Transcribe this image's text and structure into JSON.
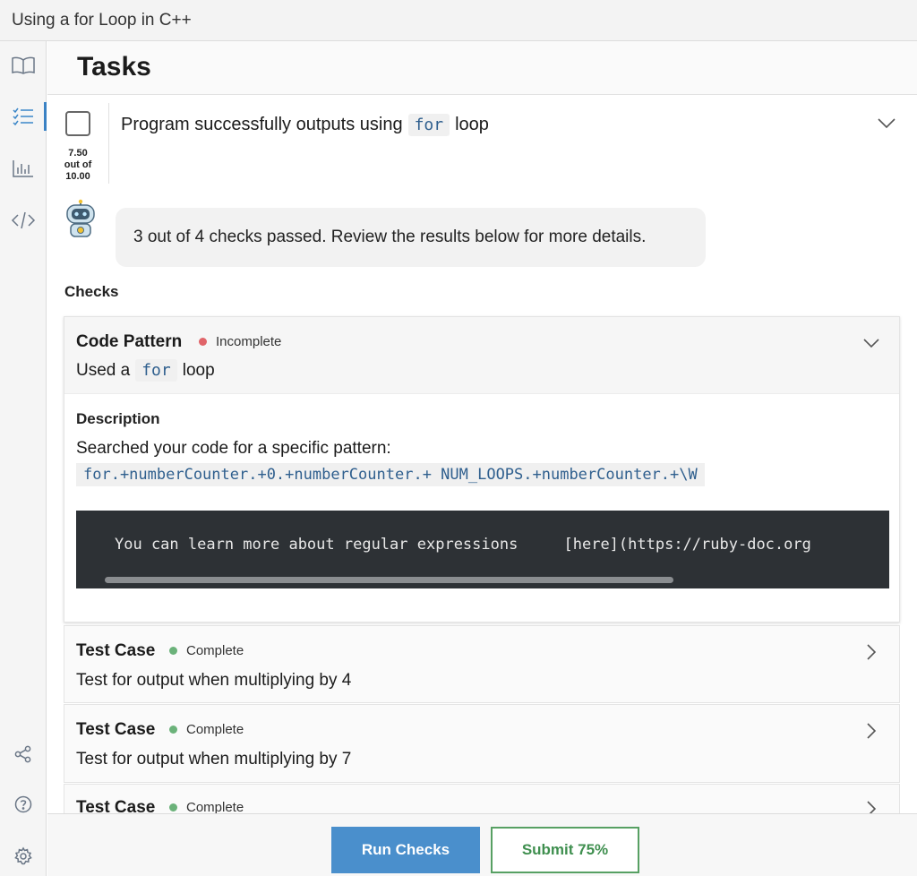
{
  "window": {
    "title": "Using a for Loop in C++"
  },
  "sidebar": {
    "icons": [
      "book-icon",
      "checklist-icon",
      "bar-chart-icon",
      "code-icon"
    ],
    "bottom_icons": [
      "share-icon",
      "help-icon",
      "settings-icon"
    ],
    "active": "checklist-icon",
    "accent": "#3b82c4"
  },
  "tasks": {
    "heading": "Tasks",
    "task": {
      "score_line1": "7.50",
      "score_line2": "out of",
      "score_line3": "10.00",
      "title_before": "Program successfully outputs using",
      "title_code": "for",
      "title_after": "loop"
    },
    "bot_message": "3 out of 4 checks passed. Review the results below for more details.",
    "checks_label": "Checks"
  },
  "checks": [
    {
      "type": "Code Pattern",
      "status": "Incomplete",
      "status_color": "#e06469",
      "sub_before": "Used a",
      "sub_code": "for",
      "sub_after": "loop",
      "description_label": "Description",
      "description": "Searched your code for a specific pattern:",
      "pattern": "for.+numberCounter.+0.+numberCounter.+ NUM_LOOPS.+numberCounter.+\\W",
      "code_block": "You can learn more about regular expressions     [here](https://ruby-doc.org"
    },
    {
      "type": "Test Case",
      "status": "Complete",
      "status_color": "#6bb27a",
      "sub": "Test for output when multiplying by 4"
    },
    {
      "type": "Test Case",
      "status": "Complete",
      "status_color": "#6bb27a",
      "sub": "Test for output when multiplying by 7"
    },
    {
      "type": "Test Case",
      "status": "Complete",
      "status_color": "#6bb27a"
    }
  ],
  "footer": {
    "run_label": "Run Checks",
    "submit_label": "Submit 75%"
  }
}
